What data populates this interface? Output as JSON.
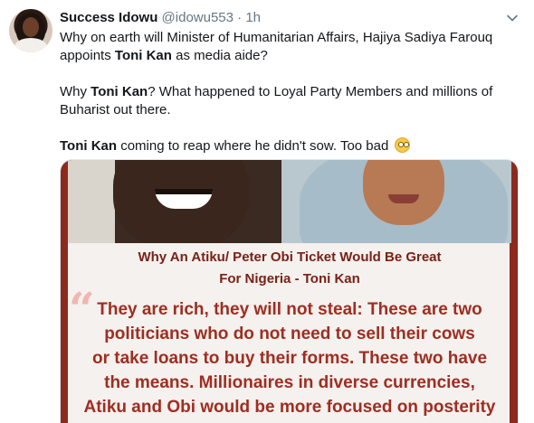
{
  "tweet": {
    "author_name": "Success Idowu",
    "author_handle": "@idowu553",
    "separator": "·",
    "time": "1h",
    "text_lines": {
      "p1": "Why on earth will Minister of Humanitarian Affairs, Hajiya Sadiya Farouq appoints ",
      "p1_bold": "Toni Kan",
      "p1_end": " as media aide?",
      "p2_start": "Why ",
      "p2_bold": "Toni Kan",
      "p2_end": "? What happened to Loyal Party Members and millions of Buharist out there.",
      "p3_bold": "Toni Kan",
      "p3_end": " coming to reap where he didn't sow. Too bad"
    },
    "emoji_icon": "face-with-rolling-eyes"
  },
  "media": {
    "headline_line1": "Why An Atiku/ Peter Obi Ticket Would Be Great",
    "headline_line2": "For Nigeria - Toni Kan",
    "quote_mark": "“",
    "quote_lines": [
      "They are rich, they will not steal: These are two",
      "politicians who do not need to sell their cows",
      "or take loans to buy their forms. These two have",
      "the means. Millionaires in diverse currencies,",
      "Atiku and Obi would be more focused on posterity"
    ]
  },
  "colors": {
    "accent_red": "#8d2a1e",
    "headline_text": "#7a2117",
    "quote_text": "#a02d21",
    "muted_text": "#657786"
  },
  "icons": {
    "more_menu": "chevron-down-icon",
    "avatar": "user-avatar"
  }
}
